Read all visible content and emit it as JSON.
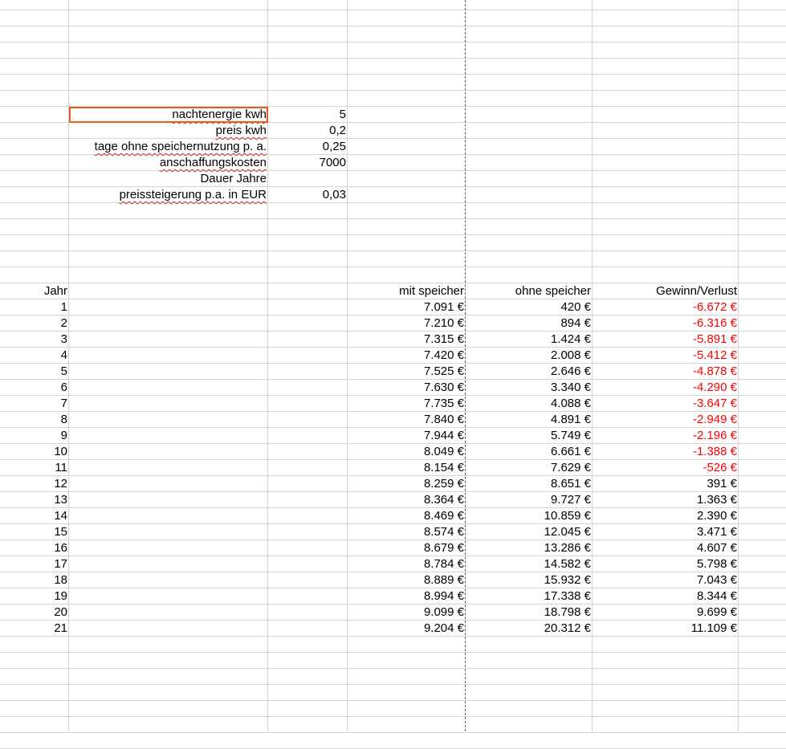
{
  "parameters": [
    {
      "label": "nachtenergie kwh",
      "value": "5",
      "misspelled": true
    },
    {
      "label": "preis kwh",
      "value": "0,2",
      "misspelled": true
    },
    {
      "label": "tage ohne speichernutzung p. a.",
      "value": "0,25",
      "misspelled": true
    },
    {
      "label": "anschaffungskosten",
      "value": "7000",
      "misspelled": true
    },
    {
      "label": "Dauer Jahre",
      "value": "",
      "misspelled": false
    },
    {
      "label": "preissteigerung p.a. in EUR",
      "value": "0,03",
      "misspelled": true
    }
  ],
  "table": {
    "headers": {
      "year": "Jahr",
      "with": "mit speicher",
      "without": "ohne speicher",
      "profit": "Gewinn/Verlust"
    },
    "rows": [
      {
        "year": "1",
        "with": "7.091 €",
        "without": "420 €",
        "profit": "-6.672 €"
      },
      {
        "year": "2",
        "with": "7.210 €",
        "without": "894 €",
        "profit": "-6.316 €"
      },
      {
        "year": "3",
        "with": "7.315 €",
        "without": "1.424 €",
        "profit": "-5.891 €"
      },
      {
        "year": "4",
        "with": "7.420 €",
        "without": "2.008 €",
        "profit": "-5.412 €"
      },
      {
        "year": "5",
        "with": "7.525 €",
        "without": "2.646 €",
        "profit": "-4.878 €"
      },
      {
        "year": "6",
        "with": "7.630 €",
        "without": "3.340 €",
        "profit": "-4.290 €"
      },
      {
        "year": "7",
        "with": "7.735 €",
        "without": "4.088 €",
        "profit": "-3.647 €"
      },
      {
        "year": "8",
        "with": "7.840 €",
        "without": "4.891 €",
        "profit": "-2.949 €"
      },
      {
        "year": "9",
        "with": "7.944 €",
        "without": "5.749 €",
        "profit": "-2.196 €"
      },
      {
        "year": "10",
        "with": "8.049 €",
        "without": "6.661 €",
        "profit": "-1.388 €"
      },
      {
        "year": "11",
        "with": "8.154 €",
        "without": "7.629 €",
        "profit": "-526 €"
      },
      {
        "year": "12",
        "with": "8.259 €",
        "without": "8.651 €",
        "profit": "391 €"
      },
      {
        "year": "13",
        "with": "8.364 €",
        "without": "9.727 €",
        "profit": "1.363 €"
      },
      {
        "year": "14",
        "with": "8.469 €",
        "without": "10.859 €",
        "profit": "2.390 €"
      },
      {
        "year": "15",
        "with": "8.574 €",
        "without": "12.045 €",
        "profit": "3.471 €"
      },
      {
        "year": "16",
        "with": "8.679 €",
        "without": "13.286 €",
        "profit": "4.607 €"
      },
      {
        "year": "17",
        "with": "8.784 €",
        "without": "14.582 €",
        "profit": "5.798 €"
      },
      {
        "year": "18",
        "with": "8.889 €",
        "without": "15.932 €",
        "profit": "7.043 €"
      },
      {
        "year": "19",
        "with": "8.994 €",
        "without": "17.338 €",
        "profit": "8.344 €"
      },
      {
        "year": "20",
        "with": "9.099 €",
        "without": "18.798 €",
        "profit": "9.699 €"
      },
      {
        "year": "21",
        "with": "9.204 €",
        "without": "20.312 €",
        "profit": "11.109 €"
      }
    ]
  },
  "colors": {
    "negative": "#ff0000",
    "selection_border": "#e95c1c",
    "grid": "#d4d4d4"
  }
}
